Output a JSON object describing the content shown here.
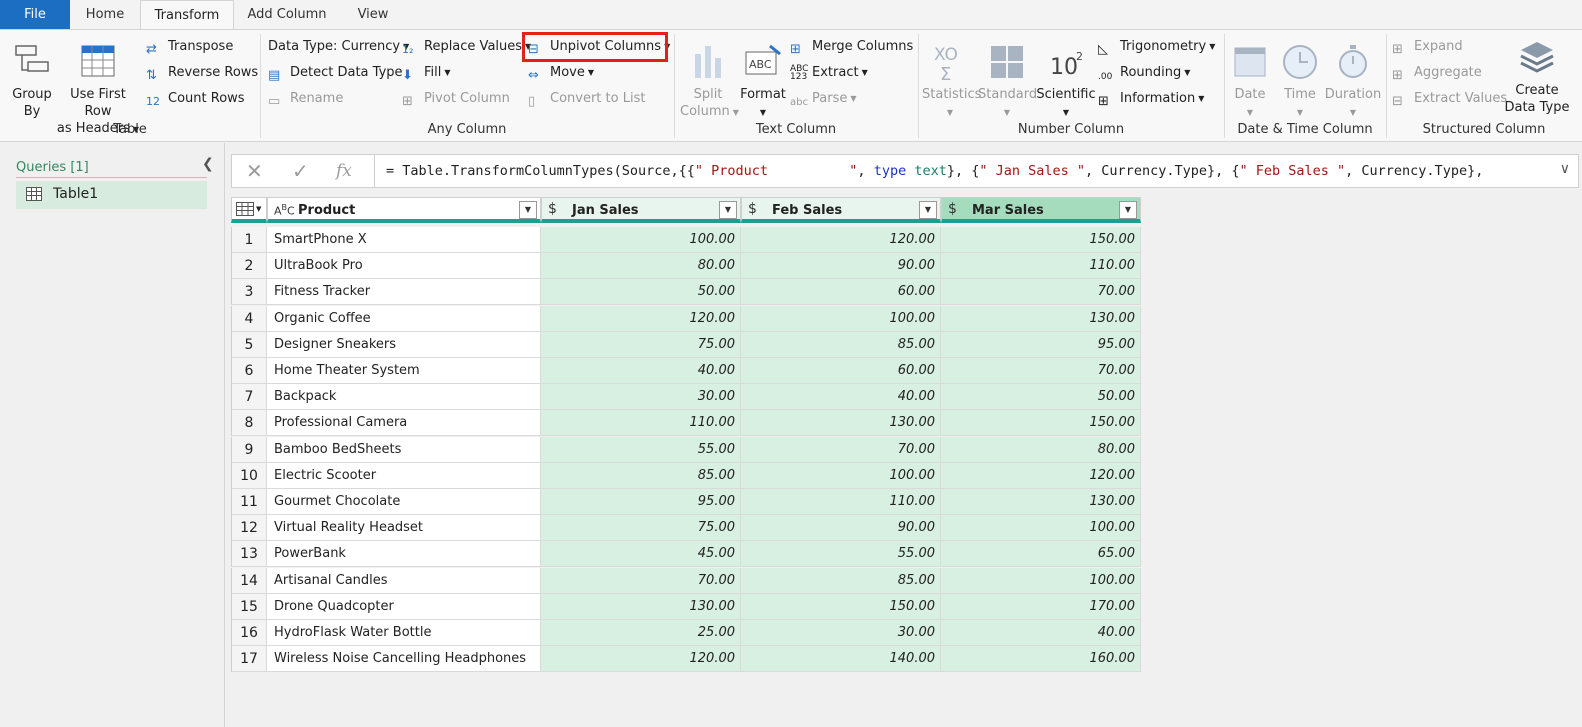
{
  "tabs": {
    "file": "File",
    "home": "Home",
    "transform": "Transform",
    "add_column": "Add Column",
    "view": "View"
  },
  "ribbon": {
    "table_group": {
      "label": "Table",
      "group_by": "Group\nBy",
      "use_first_row": "Use First Row",
      "as_headers": "as Headers",
      "transpose": "Transpose",
      "reverse_rows": "Reverse Rows",
      "count_rows": "Count Rows"
    },
    "any_column_group": {
      "label": "Any Column",
      "data_type": "Data Type: Currency",
      "detect_data_type": "Detect Data Type",
      "rename": "Rename",
      "replace_values": "Replace Values",
      "fill": "Fill",
      "pivot_column": "Pivot Column",
      "unpivot_columns": "Unpivot Columns",
      "move": "Move",
      "convert_to_list": "Convert to List"
    },
    "text_column_group": {
      "label": "Text Column",
      "split_column": "Split",
      "split_column2": "Column",
      "format": "Format",
      "merge_columns": "Merge Columns",
      "extract": "Extract",
      "parse": "Parse"
    },
    "number_column_group": {
      "label": "Number Column",
      "statistics": "Statistics",
      "standard": "Standard",
      "scientific": "Scientific",
      "trigonometry": "Trigonometry",
      "rounding": "Rounding",
      "information": "Information"
    },
    "datetime_group": {
      "label": "Date & Time Column",
      "date": "Date",
      "time": "Time",
      "duration": "Duration"
    },
    "structured_group": {
      "label": "Structured Column",
      "expand": "Expand",
      "aggregate": "Aggregate",
      "extract_values": "Extract Values",
      "create": "Create",
      "data_type": "Data Type"
    }
  },
  "queries": {
    "header": "Queries [1]",
    "items": [
      {
        "name": "Table1"
      }
    ]
  },
  "formula": {
    "p1": "= Table.TransformColumnTypes(Source,{{",
    "s1": "\" Product          \"",
    "p2": ", ",
    "k1": "type",
    "p3": " ",
    "t1": "text",
    "p4": "}, {",
    "s2": "\" Jan Sales \"",
    "p5": ", Currency.Type}, {",
    "s3": "\" Feb Sales \"",
    "p6": ", Currency.Type},"
  },
  "columns": {
    "product": "Product",
    "jan": "Jan Sales",
    "feb": "Feb Sales",
    "mar": "Mar Sales"
  },
  "rows": [
    {
      "i": "1",
      "product": "SmartPhone X",
      "jan": "100.00",
      "feb": "120.00",
      "mar": "150.00"
    },
    {
      "i": "2",
      "product": "UltraBook Pro",
      "jan": "80.00",
      "feb": "90.00",
      "mar": "110.00"
    },
    {
      "i": "3",
      "product": "Fitness Tracker",
      "jan": "50.00",
      "feb": "60.00",
      "mar": "70.00"
    },
    {
      "i": "4",
      "product": "Organic Coffee",
      "jan": "120.00",
      "feb": "100.00",
      "mar": "130.00"
    },
    {
      "i": "5",
      "product": "Designer Sneakers",
      "jan": "75.00",
      "feb": "85.00",
      "mar": "95.00"
    },
    {
      "i": "6",
      "product": "Home Theater System",
      "jan": "40.00",
      "feb": "60.00",
      "mar": "70.00"
    },
    {
      "i": "7",
      "product": "Backpack",
      "jan": "30.00",
      "feb": "40.00",
      "mar": "50.00"
    },
    {
      "i": "8",
      "product": "Professional Camera",
      "jan": "110.00",
      "feb": "130.00",
      "mar": "150.00"
    },
    {
      "i": "9",
      "product": "Bamboo BedSheets",
      "jan": "55.00",
      "feb": "70.00",
      "mar": "80.00"
    },
    {
      "i": "10",
      "product": "Electric Scooter",
      "jan": "85.00",
      "feb": "100.00",
      "mar": "120.00"
    },
    {
      "i": "11",
      "product": "Gourmet Chocolate",
      "jan": "95.00",
      "feb": "110.00",
      "mar": "130.00"
    },
    {
      "i": "12",
      "product": "Virtual Reality Headset",
      "jan": "75.00",
      "feb": "90.00",
      "mar": "100.00"
    },
    {
      "i": "13",
      "product": "PowerBank",
      "jan": "45.00",
      "feb": "55.00",
      "mar": "65.00"
    },
    {
      "i": "14",
      "product": "Artisanal Candles",
      "jan": "70.00",
      "feb": "85.00",
      "mar": "100.00"
    },
    {
      "i": "15",
      "product": "Drone Quadcopter",
      "jan": "130.00",
      "feb": "150.00",
      "mar": "170.00"
    },
    {
      "i": "16",
      "product": "HydroFlask Water Bottle",
      "jan": "25.00",
      "feb": "30.00",
      "mar": "40.00"
    },
    {
      "i": "17",
      "product": "Wireless Noise Cancelling Headphones",
      "jan": "120.00",
      "feb": "140.00",
      "mar": "160.00"
    }
  ]
}
